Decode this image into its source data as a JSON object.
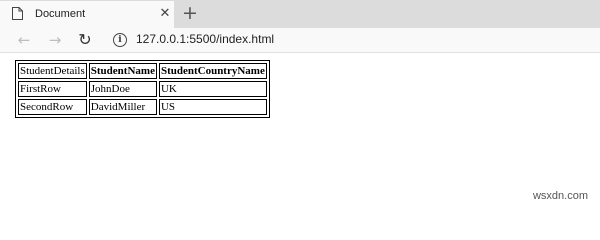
{
  "tab": {
    "title": "Document",
    "close_glyph": "✕",
    "icon": "document-icon"
  },
  "new_tab_glyph": "+",
  "toolbar": {
    "back_glyph": "←",
    "forward_glyph": "→",
    "reload_glyph": "↻",
    "info_glyph": "i",
    "url": "127.0.0.1:5500/index.html"
  },
  "table": {
    "headers": [
      "StudentDetails",
      "StudentName",
      "StudentCountryName"
    ],
    "rows": [
      [
        "FirstRow",
        "JohnDoe",
        "UK"
      ],
      [
        "SecondRow",
        "DavidMiller",
        "US"
      ]
    ]
  },
  "watermark": "wsxdn.com",
  "colors": {
    "tabstrip": "#dcdcdc",
    "toolbar": "#f9f9f9",
    "page": "#ffffff"
  }
}
